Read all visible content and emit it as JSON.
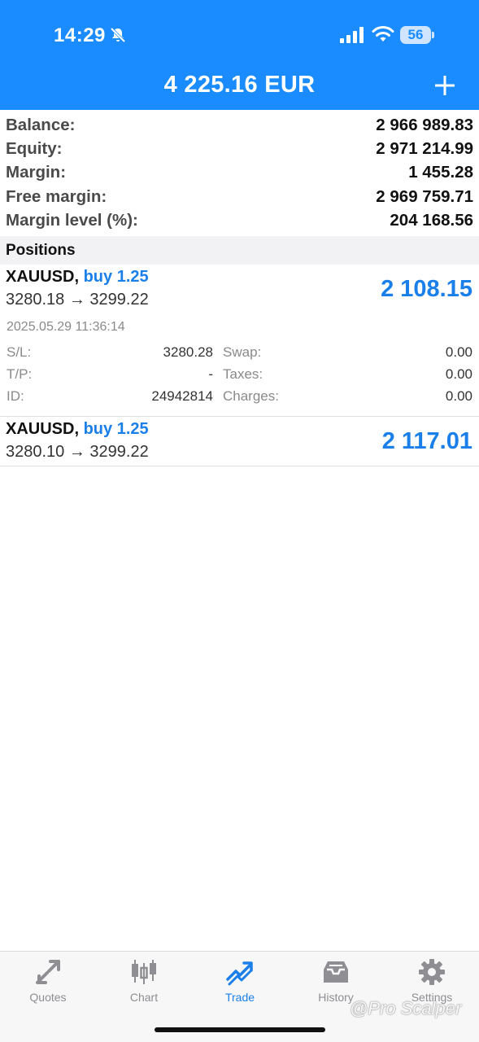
{
  "status": {
    "time": "14:29",
    "battery": "56"
  },
  "header": {
    "title": "4 225.16 EUR"
  },
  "summary": [
    {
      "label": "Balance:",
      "value": "2 966 989.83"
    },
    {
      "label": "Equity:",
      "value": "2 971 214.99"
    },
    {
      "label": "Margin:",
      "value": "1 455.28"
    },
    {
      "label": "Free margin:",
      "value": "2 969 759.71"
    },
    {
      "label": "Margin level (%):",
      "value": "204 168.56"
    }
  ],
  "positions_title": "Positions",
  "positions": [
    {
      "symbol": "XAUUSD,",
      "side": "buy 1.25",
      "prices": "3280.18 → 3299.22",
      "profit": "2 108.15",
      "time": "2025.05.29 11:36:14",
      "details": {
        "sl_label": "S/L:",
        "sl": "3280.28",
        "tp_label": "T/P:",
        "tp": "-",
        "id_label": "ID:",
        "id": "24942814",
        "swap_label": "Swap:",
        "swap": "0.00",
        "taxes_label": "Taxes:",
        "taxes": "0.00",
        "charges_label": "Charges:",
        "charges": "0.00"
      }
    },
    {
      "symbol": "XAUUSD,",
      "side": "buy 1.25",
      "prices": "3280.10 → 3299.22",
      "profit": "2 117.01"
    }
  ],
  "tabs": [
    {
      "label": "Quotes",
      "icon": "quotes-arrows-icon"
    },
    {
      "label": "Chart",
      "icon": "candlestick-icon"
    },
    {
      "label": "Trade",
      "icon": "trade-trend-icon",
      "active": true
    },
    {
      "label": "History",
      "icon": "inbox-tray-icon"
    },
    {
      "label": "Settings",
      "icon": "gear-icon"
    }
  ],
  "watermark": "@Pro Scalper",
  "colors": {
    "accent": "#1a8cff",
    "profit": "#1a7fe8"
  }
}
